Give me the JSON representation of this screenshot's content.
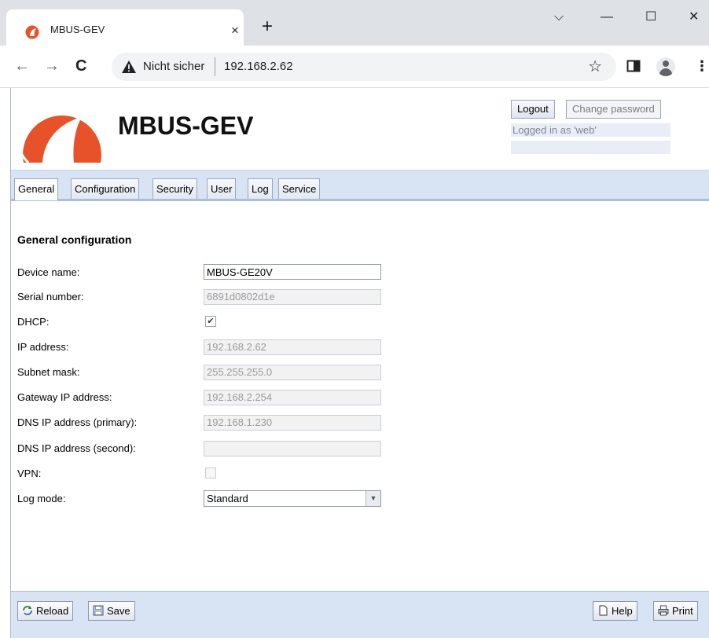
{
  "browser": {
    "tab_title": "MBUS-GEV",
    "tab_close": "×",
    "new_tab": "+",
    "window_controls": {
      "minimize": "—",
      "maximize": "☐",
      "close": "✕",
      "tab_search": "⌵"
    },
    "nav": {
      "back": "←",
      "forward": "→",
      "reload": "C"
    },
    "security_label": "Nicht sicher",
    "url": "192.168.2.62",
    "icons": [
      "star-icon",
      "side-panel-icon",
      "profile-icon",
      "menu-dots-icon"
    ]
  },
  "app": {
    "brand": "MBUS-GEV",
    "logo_color": "#e8522a",
    "logout_label": "Logout",
    "change_password_label": "Change password",
    "logged_in_text": "Logged in as 'web'"
  },
  "tabs": [
    {
      "label": "General",
      "active": true
    },
    {
      "label": "Configuration",
      "active": false
    },
    {
      "label": "Security",
      "active": false
    },
    {
      "label": "User",
      "active": false
    },
    {
      "label": "Log",
      "active": false
    },
    {
      "label": "Service",
      "active": false
    }
  ],
  "form": {
    "title": "General configuration",
    "device_name": {
      "label": "Device name:",
      "value": "MBUS-GE20V"
    },
    "serial_number": {
      "label": "Serial number:",
      "value": "6891d0802d1e"
    },
    "dhcp": {
      "label": "DHCP:",
      "checked": true
    },
    "ip_address": {
      "label": "IP address:",
      "value": "192.168.2.62"
    },
    "subnet_mask": {
      "label": "Subnet mask:",
      "value": "255.255.255.0"
    },
    "gateway": {
      "label": "Gateway IP address:",
      "value": "192.168.2.254"
    },
    "dns_primary": {
      "label": "DNS IP address (primary):",
      "value": "192.168.1.230"
    },
    "dns_second": {
      "label": "DNS IP address (second):",
      "value": ""
    },
    "vpn": {
      "label": "VPN:",
      "checked": false
    },
    "log_mode": {
      "label": "Log mode:",
      "value": "Standard"
    }
  },
  "footer": {
    "reload_label": "Reload",
    "save_label": "Save",
    "help_label": "Help",
    "print_label": "Print"
  },
  "colors": {
    "accent": "#e8522a",
    "tabbar_bg": "#d8e3f3",
    "tabbar_border": "#a8bede"
  }
}
